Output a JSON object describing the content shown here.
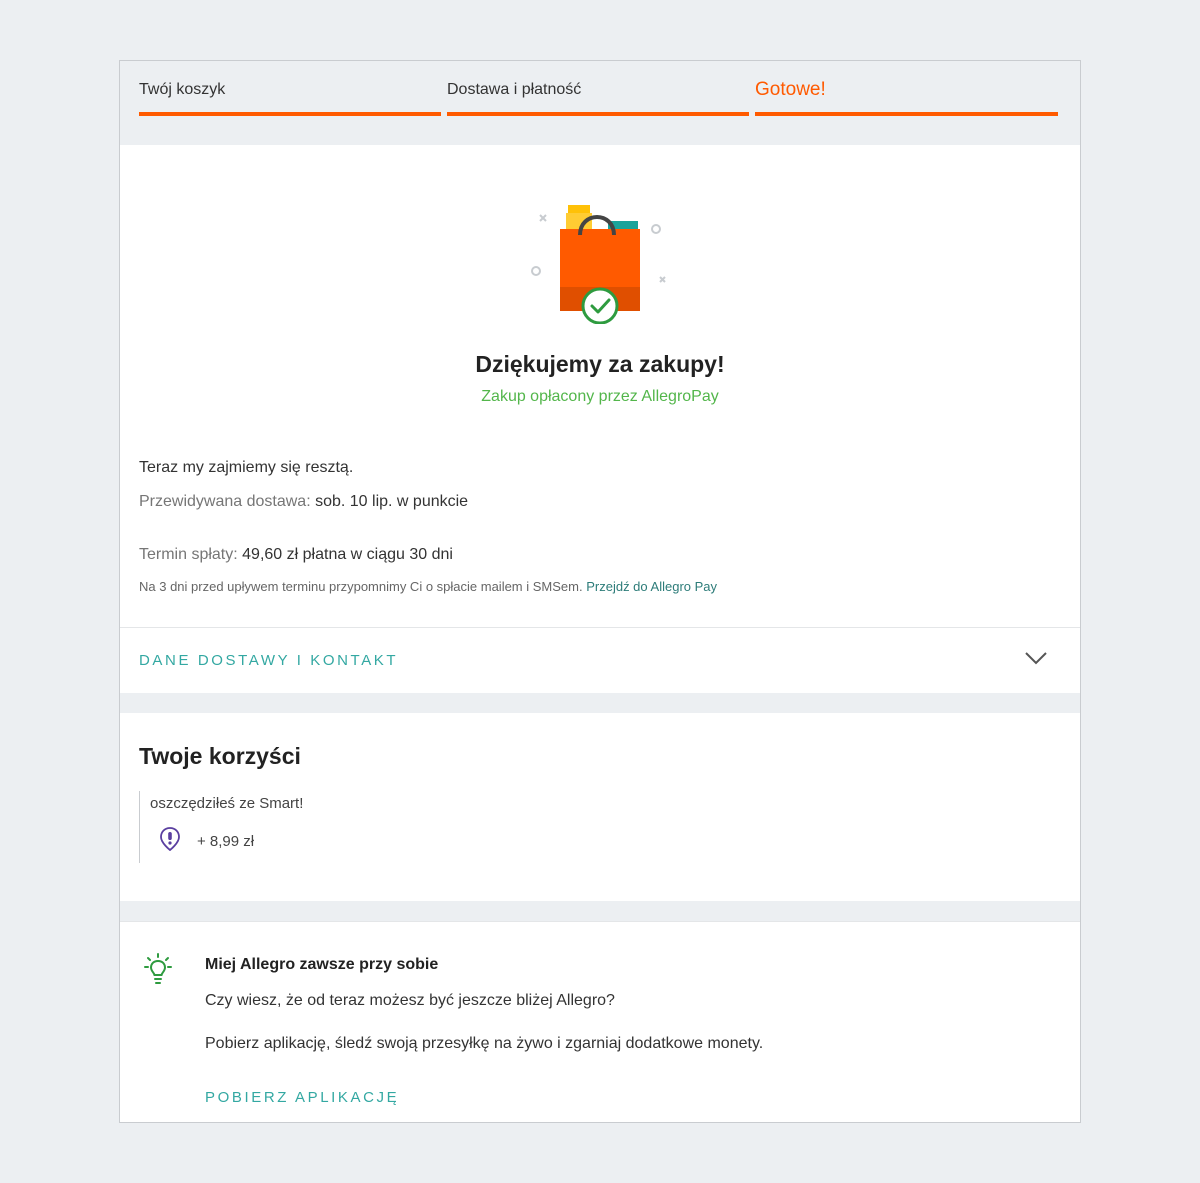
{
  "stepper": {
    "steps": [
      {
        "label": "Twój koszyk"
      },
      {
        "label": "Dostawa i płatność"
      },
      {
        "label": "Gotowe!"
      }
    ]
  },
  "confirmation": {
    "title": "Dziękujemy za zakupy!",
    "paid_by": "Zakup opłacony przez AllegroPay",
    "rest_text": "Teraz my zajmiemy się resztą.",
    "delivery_label": "Przewidywana dostawa:",
    "delivery_value": "sob. 10 lip. w punkcie",
    "term_label": "Termin spłaty:",
    "term_value": "49,60 zł płatna w ciągu 30 dni",
    "reminder_text": "Na 3 dni przed upływem terminu przypomnimy Ci o spłacie mailem i SMSem.",
    "reminder_link": "Przejdź do Allegro Pay"
  },
  "delivery_section": {
    "label": "DANE DOSTAWY I KONTAKT"
  },
  "benefits": {
    "title": "Twoje korzyści",
    "label": "oszczędziłeś ze Smart!",
    "value": "+ 8,99 zł"
  },
  "app_promo": {
    "title": "Miej Allegro zawsze przy sobie",
    "question": "Czy wiesz, że od teraz możesz być jeszcze bliżej Allegro?",
    "description": "Pobierz aplikację, śledź swoją przesyłkę na żywo i zgarniaj dodatkowe monety.",
    "link": "POBIERZ APLIKACJĘ"
  },
  "colors": {
    "accent_orange": "#ff5a00",
    "success_green": "#53b64b",
    "teal_link": "#33a8a2",
    "smart_purple": "#5a3fa0"
  }
}
